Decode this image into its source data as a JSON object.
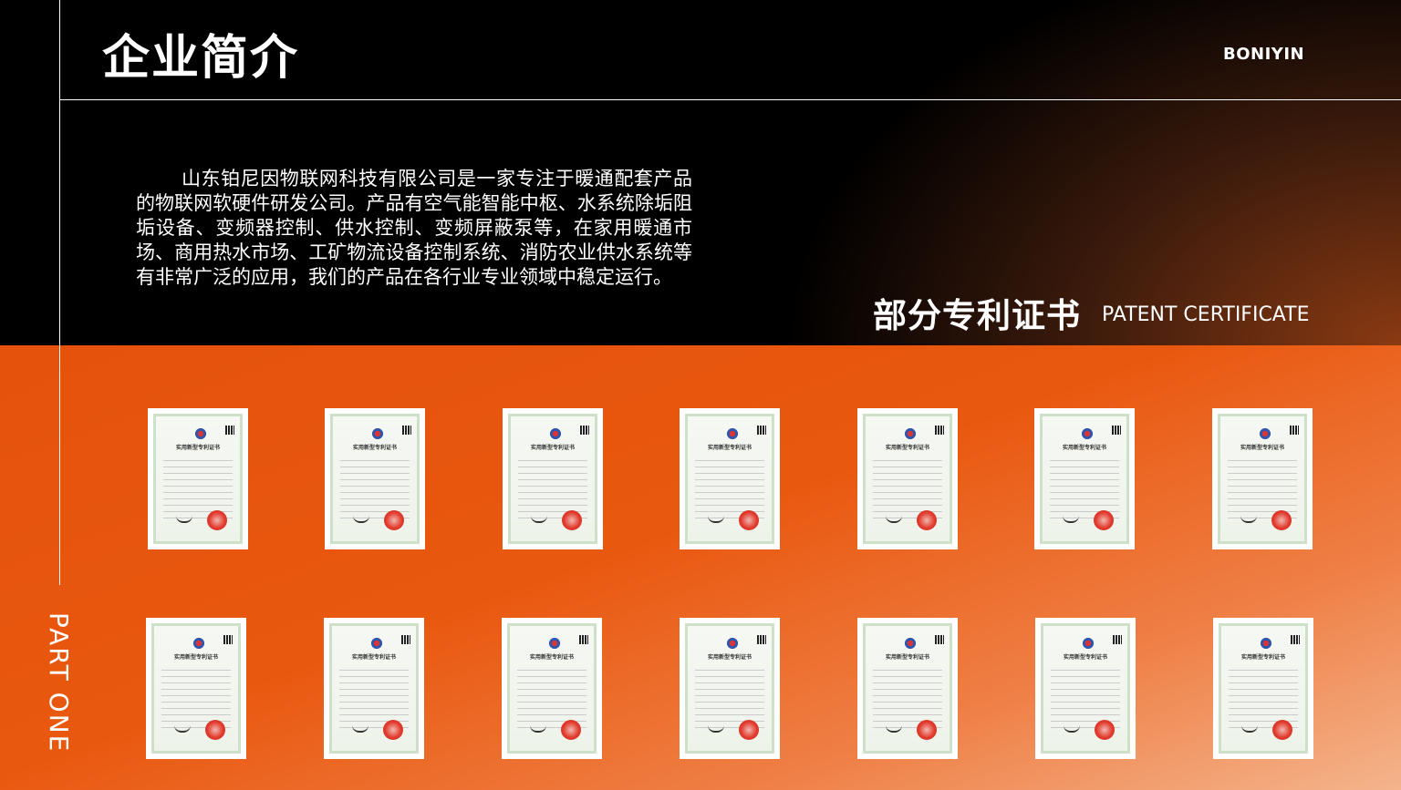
{
  "header": {
    "title": "企业简介",
    "brand": "BONIYIN"
  },
  "intro": {
    "text": "山东铂尼因物联网科技有限公司是一家专注于暖通配套产品的物联网软硬件研发公司。产品有空气能智能中枢、水系统除垢阻垢设备、变频器控制、供水控制、变频屏蔽泵等，在家用暖通市场、商用热水市场、工矿物流设备控制系统、消防农业供水系统等有非常广泛的应用，我们的产品在各行业专业领域中稳定运行。"
  },
  "patent": {
    "title_cn": "部分专利证书",
    "title_en": "PATENT CERTIFICATE"
  },
  "side": {
    "part_label": "PART ONE"
  },
  "certificates": {
    "row1": [
      {
        "caption": "实用新型专利证书",
        "icon": "certificate-image"
      },
      {
        "caption": "实用新型专利证书",
        "icon": "certificate-image"
      },
      {
        "caption": "实用新型专利证书",
        "icon": "certificate-image"
      },
      {
        "caption": "实用新型专利证书",
        "icon": "certificate-image"
      },
      {
        "caption": "实用新型专利证书",
        "icon": "certificate-image"
      },
      {
        "caption": "实用新型专利证书",
        "icon": "certificate-image"
      },
      {
        "caption": "实用新型专利证书",
        "icon": "certificate-image"
      }
    ],
    "row2": [
      {
        "caption": "实用新型专利证书",
        "icon": "certificate-image"
      },
      {
        "caption": "实用新型专利证书",
        "icon": "certificate-image"
      },
      {
        "caption": "实用新型专利证书",
        "icon": "certificate-image"
      },
      {
        "caption": "实用新型专利证书",
        "icon": "certificate-image"
      },
      {
        "caption": "实用新型专利证书",
        "icon": "certificate-image"
      },
      {
        "caption": "实用新型专利证书",
        "icon": "certificate-image"
      },
      {
        "caption": "实用新型专利证书",
        "icon": "certificate-image"
      }
    ]
  },
  "colors": {
    "accent": "#e9580f",
    "background_dark": "#000000",
    "text": "#ffffff"
  }
}
